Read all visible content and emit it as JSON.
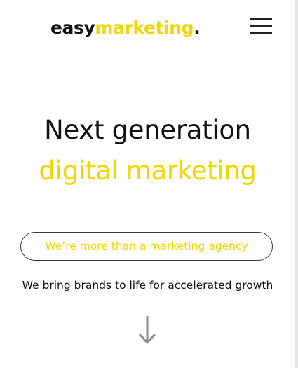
{
  "header": {
    "logo": {
      "part1": "easy",
      "part2": "marketing",
      "part3": "."
    },
    "menu_icon": "hamburger-menu-icon"
  },
  "hero": {
    "line1": "Next generation",
    "line2": "digital marketing"
  },
  "cta": {
    "label": "We’re more than a marketing agency"
  },
  "subtitle": "We bring brands to life for accelerated growth",
  "scroll_icon": "arrow-down-icon",
  "colors": {
    "accent": "#f2d600",
    "text": "#111111",
    "background": "#ffffff"
  }
}
